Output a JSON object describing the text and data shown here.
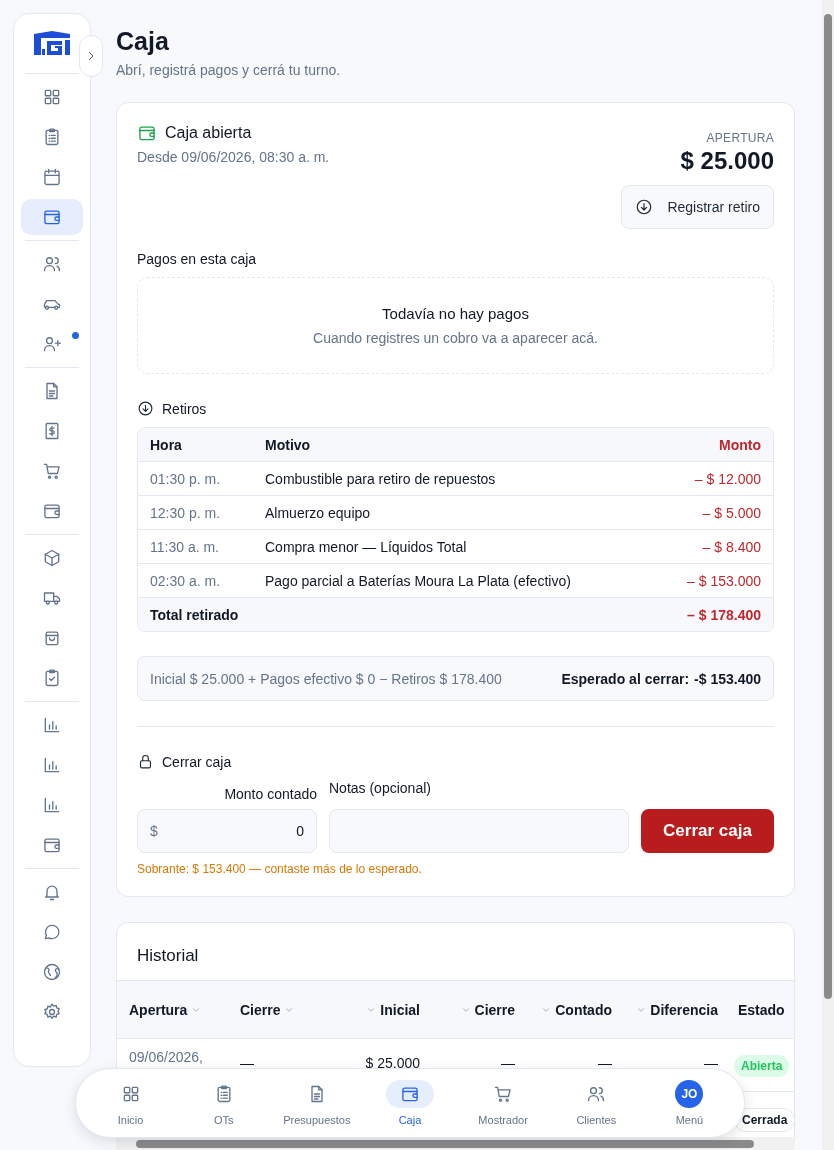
{
  "sidebar": {
    "groups": [
      [
        {
          "selected": false,
          "dot": false
        },
        {
          "selected": false,
          "dot": false
        },
        {
          "selected": false,
          "dot": false
        },
        {
          "selected": true,
          "dot": false
        }
      ],
      [
        {
          "selected": false,
          "dot": false
        },
        {
          "selected": false,
          "dot": false
        },
        {
          "selected": false,
          "dot": true
        }
      ],
      [
        {
          "selected": false,
          "dot": false
        },
        {
          "selected": false,
          "dot": false
        },
        {
          "selected": false,
          "dot": false
        },
        {
          "selected": false,
          "dot": false
        }
      ],
      [
        {
          "selected": false,
          "dot": false
        },
        {
          "selected": false,
          "dot": false
        },
        {
          "selected": false,
          "dot": false
        },
        {
          "selected": false,
          "dot": false
        }
      ],
      [
        {
          "selected": false,
          "dot": false
        },
        {
          "selected": false,
          "dot": false
        },
        {
          "selected": false,
          "dot": false
        },
        {
          "selected": false,
          "dot": false
        }
      ],
      [
        {
          "selected": false,
          "dot": false
        },
        {
          "selected": false,
          "dot": false
        },
        {
          "selected": false,
          "dot": false
        },
        {
          "selected": false,
          "dot": false
        }
      ]
    ]
  },
  "header": {
    "title": "Caja",
    "subtitle": "Abrí, registrá pagos y cerrá tu turno."
  },
  "status_card": {
    "title": "Caja abierta",
    "since": "Desde 09/06/2026, 08:30 a. m.",
    "opening_label": "APERTURA",
    "opening_amount": "$ 25.000",
    "withdraw_button": "Registrar retiro",
    "payments": {
      "heading": "Pagos en esta caja",
      "empty_title": "Todavía no hay pagos",
      "empty_text": "Cuando registres un cobro va a aparecer acá."
    },
    "withdrawals": {
      "heading": "Retiros",
      "columns": [
        "Hora",
        "Motivo",
        "Monto"
      ],
      "rows": [
        {
          "time": "01:30 p. m.",
          "reason": "Combustible para retiro de repuestos",
          "amount": "– $ 12.000"
        },
        {
          "time": "12:30 p. m.",
          "reason": "Almuerzo equipo",
          "amount": "– $ 5.000"
        },
        {
          "time": "11:30 a. m.",
          "reason": "Compra menor — Líquidos Total",
          "amount": "– $ 8.400"
        },
        {
          "time": "02:30 a. m.",
          "reason": "Pago parcial a Baterías Moura La Plata (efectivo)",
          "amount": "– $ 153.000"
        }
      ],
      "total": {
        "label": "Total retirado",
        "amount": "– $ 178.400"
      }
    },
    "summary": {
      "formula": "Inicial $ 25.000 + Pagos efectivo $ 0 − Retiros $ 178.400",
      "expected_label": "Esperado al cerrar:",
      "expected_value": "-$ 153.400"
    },
    "close": {
      "heading": "Cerrar caja",
      "counted_label": "Monto contado",
      "currency": "$",
      "counted_value": "0",
      "notes_label": "Notas (opcional)",
      "button": "Cerrar caja",
      "message": "Sobrante: $ 153.400 — contaste más de lo esperado."
    }
  },
  "history": {
    "title": "Historial",
    "columns": [
      {
        "label": "Apertura",
        "numeric": false
      },
      {
        "label": "Cierre",
        "numeric": false
      },
      {
        "label": "Inicial",
        "numeric": true
      },
      {
        "label": "Cierre",
        "numeric": true
      },
      {
        "label": "Contado",
        "numeric": true
      },
      {
        "label": "Diferencia",
        "numeric": true
      },
      {
        "label": "Estado",
        "numeric": false,
        "unsorted": true
      }
    ],
    "rows": [
      {
        "cells": [
          "09/06/2026,",
          "—",
          "$ 25.000",
          "—",
          "—",
          "—"
        ],
        "status": {
          "text": "Abierta",
          "kind": "open"
        }
      },
      {
        "cells": [],
        "status": {
          "text": "Cerrada",
          "kind": "closed"
        }
      }
    ]
  },
  "bottom_nav": [
    {
      "label": "Inicio",
      "selected": false,
      "kind": "icon"
    },
    {
      "label": "OTs",
      "selected": false,
      "kind": "icon"
    },
    {
      "label": "Presupuestos",
      "selected": false,
      "kind": "icon"
    },
    {
      "label": "Caja",
      "selected": true,
      "kind": "icon"
    },
    {
      "label": "Mostrador",
      "selected": false,
      "kind": "icon"
    },
    {
      "label": "Clientes",
      "selected": false,
      "kind": "icon"
    },
    {
      "label": "Menú",
      "selected": false,
      "kind": "avatar",
      "initials": "JO"
    }
  ]
}
